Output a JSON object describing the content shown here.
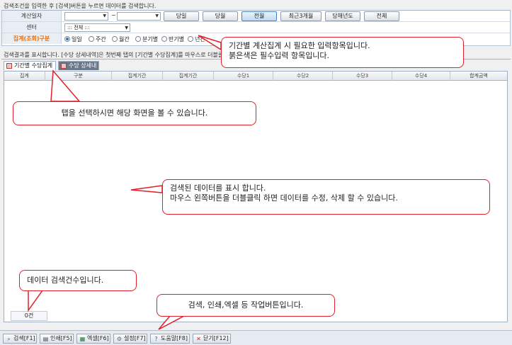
{
  "header": {
    "hint": "검색조건을 입력한 후 [검색]버튼을 누르면 데이터를 검색합니다."
  },
  "form": {
    "date_label": "계산일자",
    "tilde": "~",
    "period_buttons": [
      "당일",
      "당월",
      "전월",
      "최근3개월",
      "당해년도",
      "전체"
    ],
    "active_period": "전월",
    "center_label": "센터",
    "center_value": "::: 전체 :::",
    "group_label": "집계(조회)구분",
    "group_options": [
      "일일",
      "주간",
      "월간",
      "분기별",
      "반기별",
      "년간"
    ],
    "group_selected": "일일"
  },
  "result": {
    "info": "검색결과를 표시합니다. [수당 상세내역]은 첫번째 탭의 [기간별 수당집계]를 마우스로 더블클릭하면 표시됩니다."
  },
  "tabs": [
    {
      "label": "기간별 수당집계",
      "active": true
    },
    {
      "label": "수당 상세내역",
      "active": false
    }
  ],
  "grid": {
    "columns": [
      "집계",
      "구분",
      "집계기간",
      "집계기간",
      "수당1",
      "수당2",
      "수당3",
      "수당4",
      "합계금액"
    ],
    "rows": []
  },
  "count": {
    "text": "0건"
  },
  "toolbar": {
    "buttons": [
      {
        "label": "검색[F1]",
        "icon": "search-icon"
      },
      {
        "label": "인쇄[F5]",
        "icon": "print-icon"
      },
      {
        "label": "엑셀[F6]",
        "icon": "excel-icon"
      },
      {
        "label": "설정[F7]",
        "icon": "gear-icon"
      },
      {
        "label": "도움말[F8]",
        "icon": "help-icon"
      },
      {
        "label": "닫기[F12]",
        "icon": "close-icon"
      }
    ]
  },
  "callouts": {
    "period_input": "기간별 계산집계 시 필요한 입력항목입니다.\n붉은색은 필수입력 항목입니다.",
    "tab_select": "탭을 선택하시면 해당 화면을 볼 수 있습니다.",
    "grid_data": "검색된 데이터를 표시 합니다.\n마우스 왼쪽버튼을 더블클릭 하면 데이터를 수정, 삭제 할 수 있습니다.",
    "count": "데이터 검색건수입니다.",
    "toolbar": "검색, 인쇄,엑셀 등 작업버튼입니다."
  },
  "colors": {
    "required": "#e07018",
    "callout_border": "#e0202a",
    "active_button": "#bed8f2"
  }
}
